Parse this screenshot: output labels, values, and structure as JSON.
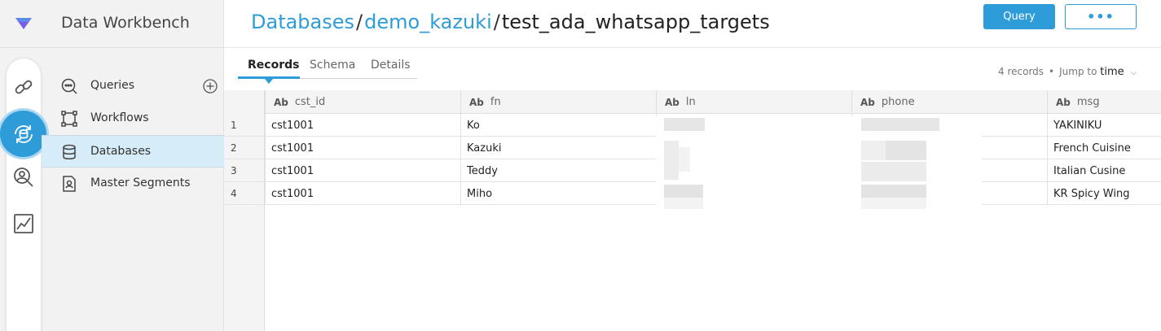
{
  "app": {
    "title": "Data Workbench",
    "accent": "#2d9cd8"
  },
  "rail": [
    {
      "name": "link-icon"
    },
    {
      "name": "data-sync-icon",
      "active": true
    },
    {
      "name": "profile-search-icon"
    },
    {
      "name": "chart-icon"
    }
  ],
  "nav": {
    "items": [
      {
        "label": "Queries",
        "icon": "query-icon"
      },
      {
        "label": "Workflows",
        "icon": "workflow-icon"
      },
      {
        "label": "Databases",
        "icon": "database-icon",
        "active": true
      },
      {
        "label": "Master Segments",
        "icon": "segment-icon"
      }
    ]
  },
  "breadcrumb": {
    "root": "Databases",
    "parent": "demo_kazuki",
    "current": "test_ada_whatsapp_targets",
    "sep": "/"
  },
  "toolbar": {
    "query_label": "Query",
    "more_label": "•••"
  },
  "tabs": [
    {
      "label": "Records",
      "active": true
    },
    {
      "label": "Schema"
    },
    {
      "label": "Details"
    }
  ],
  "meta": {
    "count": "4 records",
    "jump_label": "Jump to",
    "jump_value": "time"
  },
  "table": {
    "type_label": "Ab",
    "columns": [
      "cst_id",
      "fn",
      "ln",
      "phone",
      "msg"
    ],
    "rows": [
      {
        "n": "1",
        "cst_id": "cst1001",
        "fn": "Ko",
        "msg": "YAKINIKU"
      },
      {
        "n": "2",
        "cst_id": "cst1001",
        "fn": "Kazuki",
        "msg": "French Cuisine"
      },
      {
        "n": "3",
        "cst_id": "cst1001",
        "fn": "Teddy",
        "msg": "Italian Cusine"
      },
      {
        "n": "4",
        "cst_id": "cst1001",
        "fn": "Miho",
        "msg": "KR Spicy Wing"
      }
    ]
  }
}
